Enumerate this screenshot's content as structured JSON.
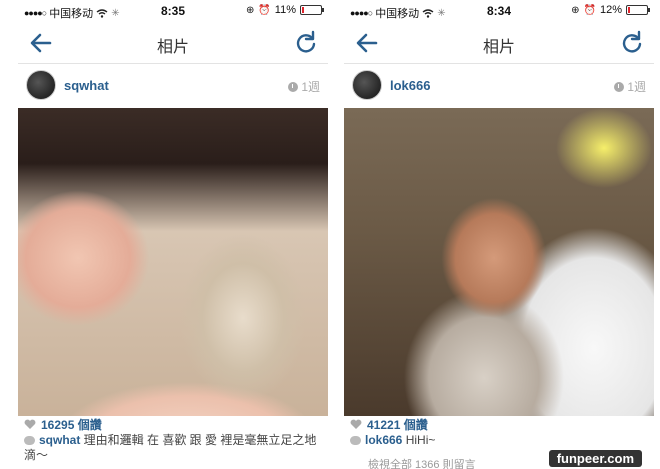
{
  "colors": {
    "accent": "#2b5f8e",
    "battery_low": "#e0242c"
  },
  "phones": [
    {
      "status": {
        "signal": "●●●●○",
        "carrier": "中国移动",
        "time": "8:35",
        "battery": "11%",
        "battery_fraction": 0.11
      },
      "nav": {
        "title": "相片"
      },
      "post": {
        "username": "sqwhat",
        "age": "1週",
        "likes": "16295 個讚",
        "comment_user": "sqwhat",
        "comment_text": " 理由和邏輯 在 喜歡 跟 愛 裡是毫無立足之地滴～"
      }
    },
    {
      "status": {
        "signal": "●●●●○",
        "carrier": "中国移动",
        "time": "8:34",
        "battery": "12%",
        "battery_fraction": 0.12
      },
      "nav": {
        "title": "相片"
      },
      "post": {
        "username": "lok666",
        "age": "1週",
        "likes": "41221 個讚",
        "comment_user": "lok666",
        "comment_text": " HiHi~",
        "view_all": "檢視全部 1366 則留言"
      }
    }
  ],
  "watermark": "funpeer.com"
}
